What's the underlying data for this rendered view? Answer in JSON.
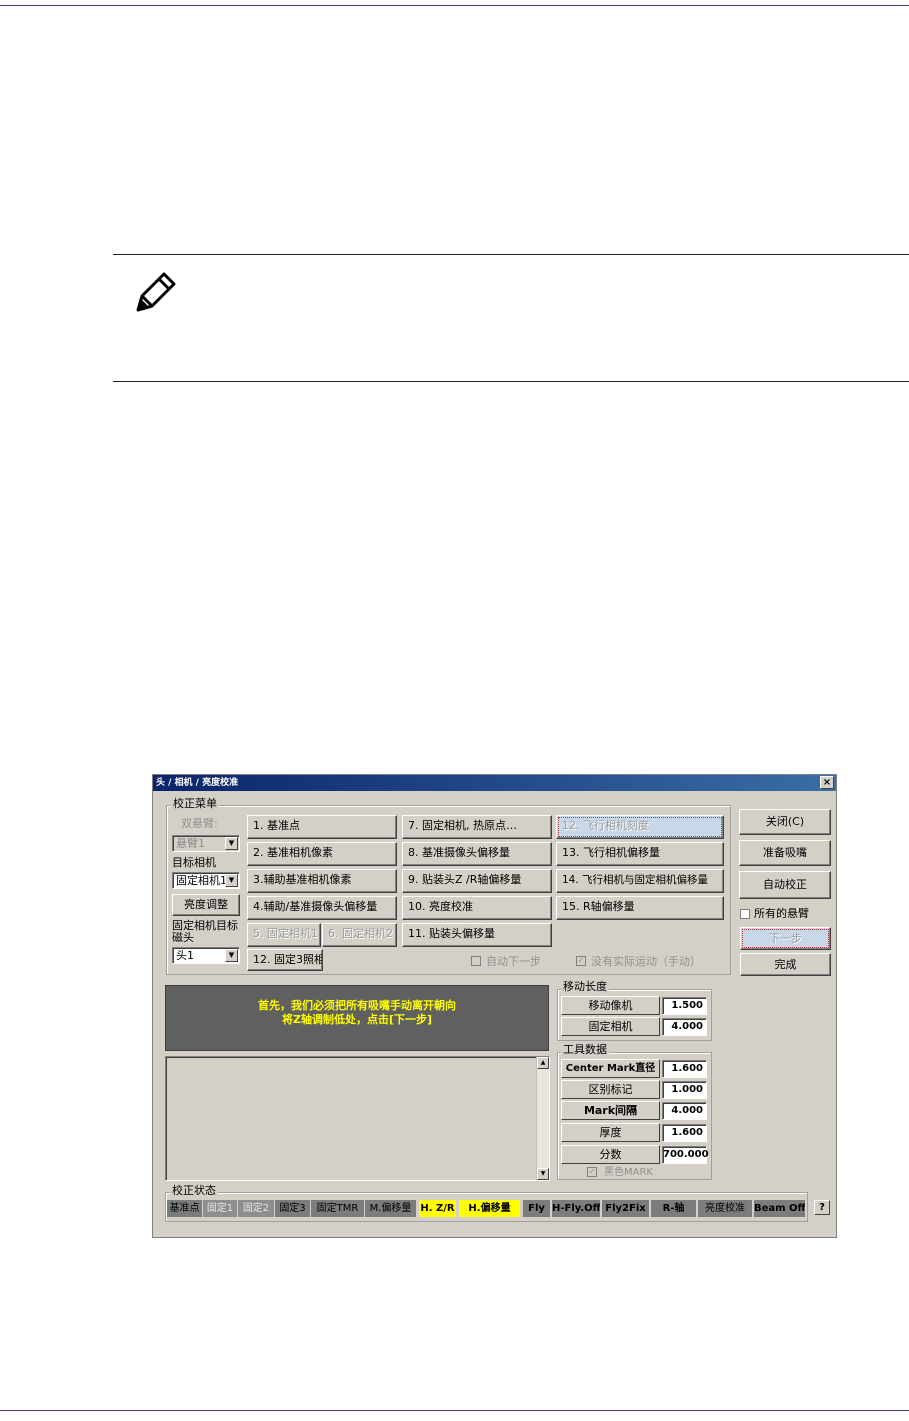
{
  "dialog": {
    "title": "头 / 相机 / 亮度校准",
    "close_glyph": "×"
  },
  "menu": {
    "label": "校正菜单",
    "dual_arm_label": "双悬臂:",
    "dual_arm_value": "悬臂1",
    "target_camera_label": "目标相机",
    "target_camera_value": "固定相机1",
    "brightness_button": "亮度调整",
    "fixed_camera_target_label": "固定相机目标磁头",
    "head_value": "头1",
    "col1": [
      "1. 基准点",
      "2. 基准相机像素",
      "3.辅助基准相机像素",
      "4.辅助/基准摄像头偏移量"
    ],
    "fixed_cam1": "5. 固定相机1",
    "fixed_cam2": "6. 固定相机2",
    "fixed3": "12. 固定3照相",
    "col2": [
      "7. 固定相机, 热原点…",
      "8. 基准摄像头偏移量",
      "9. 贴装头Z /R轴偏移量",
      "10. 亮度校准",
      "11. 贴装头偏移量"
    ],
    "col3": [
      "12. 飞行相机刻度",
      "13. 飞行相机偏移量",
      "14. 飞行相机与固定相机偏移量",
      "15. R轴偏移量"
    ],
    "auto_next": "自动下一步",
    "no_motion": "没有实际运动（手动）"
  },
  "side": {
    "close": "关闭(C)",
    "prepare_nozzle": "准备吸嘴",
    "auto_calibrate": "自动校正",
    "all_arms": "所有的悬臂",
    "next": "下一步",
    "done": "完成"
  },
  "message": {
    "line1": "首先，我们必须把所有吸嘴手动离开朝向",
    "line2": "将Z轴调制低处，点击[下一步]"
  },
  "move_length": {
    "label": "移动长度",
    "rows": [
      {
        "name": "移动像机",
        "value": "1.500"
      },
      {
        "name": "固定相机",
        "value": "4.000"
      }
    ]
  },
  "tool_data": {
    "label": "工具数据",
    "rows": [
      {
        "name": "Center Mark直径",
        "value": "1.600"
      },
      {
        "name": "区别标记",
        "value": "1.000"
      },
      {
        "name": "Mark间隔",
        "value": "4.000"
      },
      {
        "name": "厚度",
        "value": "1.600"
      },
      {
        "name": "分数",
        "value": "700.000"
      }
    ],
    "black_mark": "黑色MARK"
  },
  "status": {
    "label": "校正状态",
    "cells": [
      "基准点",
      "固定1",
      "固定2",
      "固定3",
      "固定TMR",
      "M.偏移量",
      "H. Z/R",
      "H.偏移量",
      "Fly",
      "H-Fly.Off",
      "Fly2Fix",
      "R-轴",
      "亮度校准",
      "Beam Off"
    ],
    "help": "?"
  }
}
